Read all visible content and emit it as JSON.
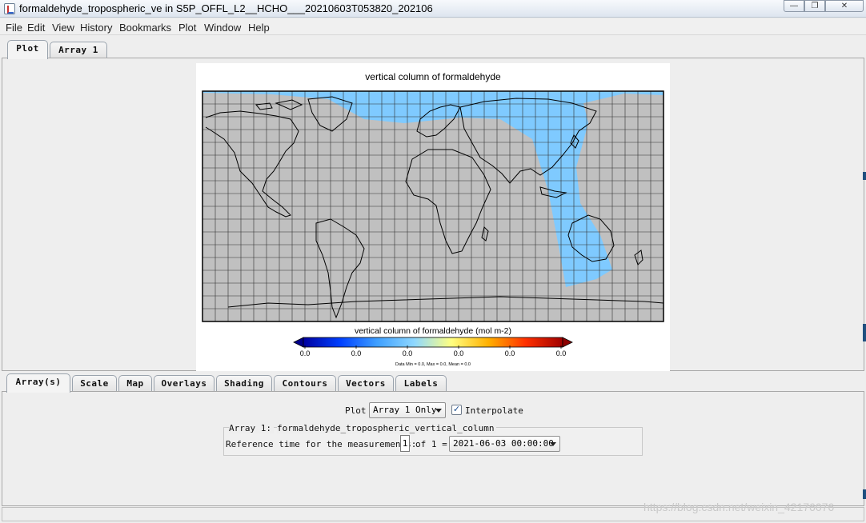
{
  "window": {
    "title": "formaldehyde_tropospheric_ve in S5P_OFFL_L2__HCHO___20210603T053820_202106",
    "minimize_glyph": "—",
    "maximize_glyph": "❐",
    "close_glyph": "✕"
  },
  "menu": [
    "File",
    "Edit",
    "View",
    "History",
    "Bookmarks",
    "Plot",
    "Window",
    "Help"
  ],
  "top_tabs": [
    {
      "label": "Plot",
      "active": true
    },
    {
      "label": "Array 1",
      "active": false
    }
  ],
  "plot": {
    "title": "vertical column of formaldehyde",
    "colorbar": {
      "label": "vertical column of formaldehyde (mol m-2)",
      "ticks": [
        "0.0",
        "0.0",
        "0.0",
        "0.0",
        "0.0",
        "0.0"
      ],
      "stats": "Data Min = 0.0, Max = 0.0, Mean = 0.0",
      "colors": [
        "#0000a0",
        "#0040ff",
        "#3fa0ff",
        "#8fd8ff",
        "#ffff80",
        "#ffb000",
        "#ff3000",
        "#a00000"
      ]
    },
    "map_colors": {
      "land_sea": "#c0c0c0",
      "swath": "#7fcaff",
      "outline": "#000000",
      "grid": "#303030"
    }
  },
  "bottom_tabs": [
    {
      "label": "Array(s)",
      "active": true
    },
    {
      "label": "Scale",
      "active": false
    },
    {
      "label": "Map",
      "active": false
    },
    {
      "label": "Overlays",
      "active": false
    },
    {
      "label": "Shading",
      "active": false
    },
    {
      "label": "Contours",
      "active": false
    },
    {
      "label": "Vectors",
      "active": false
    },
    {
      "label": "Labels",
      "active": false
    }
  ],
  "controls": {
    "plot_label": "Plot",
    "plot_mode": "Array 1 Only",
    "interpolate_label": "Interpolate",
    "interpolate_checked": true,
    "check_glyph": "✓",
    "array_label": "Array 1:",
    "array_name": "formaldehyde_tropospheric_vertical_column",
    "ref_time_label": "Reference time for the measurements:",
    "ref_index": "1",
    "ref_of": "of 1 =",
    "ref_time_value": "2021-06-03 00:00:00"
  },
  "watermark": "https://blog.csdn.net/weixin_42176076"
}
